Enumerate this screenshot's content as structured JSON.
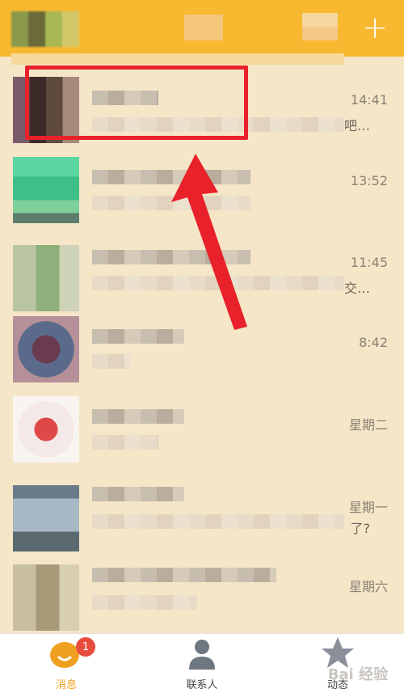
{
  "header": {
    "plus_label": "+"
  },
  "conversations": [
    {
      "time": "14:41",
      "suffix": "吧…"
    },
    {
      "time": "13:52",
      "suffix": ""
    },
    {
      "time": "11:45",
      "suffix": "交…"
    },
    {
      "time": "8:42",
      "suffix": ""
    },
    {
      "time": "星期二",
      "suffix": ""
    },
    {
      "time": "星期一",
      "suffix": "了?"
    },
    {
      "time": "星期六",
      "suffix": ""
    }
  ],
  "tabs": [
    {
      "label": "消息",
      "badge": "1",
      "color": "#f0a020"
    },
    {
      "label": "联系人",
      "color": "#444444"
    },
    {
      "label": "动态",
      "color": "#444444"
    }
  ],
  "watermark": "Bai 经验",
  "colors": {
    "header": "#f8b830",
    "background": "#f5e6c8",
    "highlight": "#e8212b",
    "badge": "#e84c3d"
  }
}
